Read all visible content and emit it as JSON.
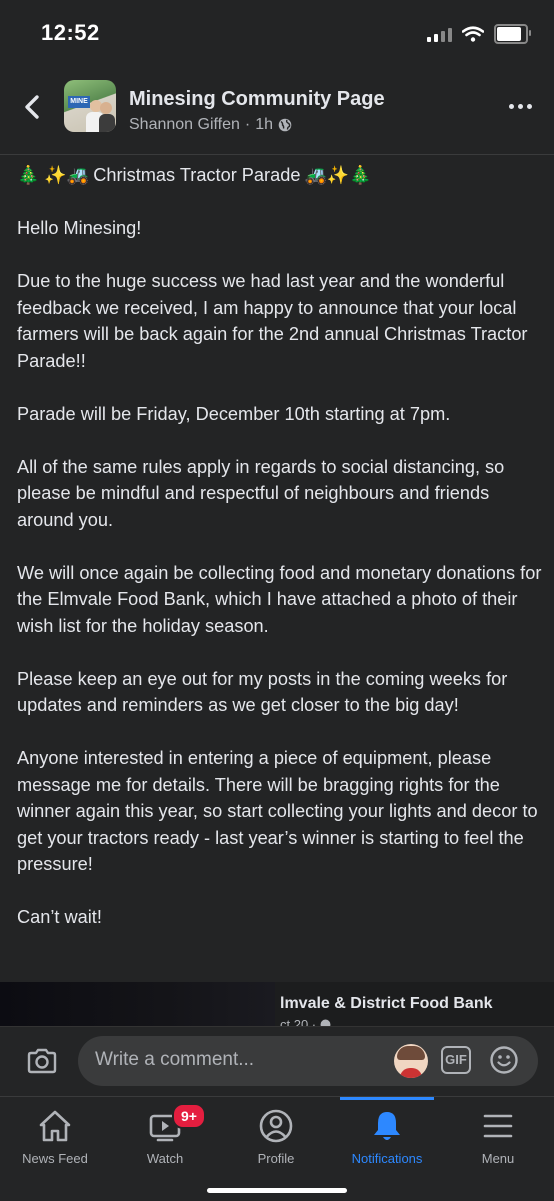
{
  "status_bar": {
    "time": "12:52",
    "battery_percent": 85
  },
  "header": {
    "page_name": "Minesing Community Page",
    "author": "Shannon Giffen",
    "separator": "·",
    "time_ago": "1h",
    "avatar_sign_text": "MINE",
    "icons": [
      "back-arrow-icon",
      "globe-icon",
      "more-options-icon"
    ]
  },
  "post": {
    "title": {
      "lead_emojis": "🎄 ✨🚜",
      "text": "Christmas Tractor Parade",
      "trail_emojis": "🚜✨🎄"
    },
    "paragraphs": [
      "Hello Minesing!",
      "Due to the huge success we had last year and the wonderful feedback we received, I am happy to announce that your local farmers will be back again for the 2nd annual Christmas Tractor Parade!!",
      "Parade will be Friday, December 10th starting at 7pm.",
      "All of the same rules apply in regards to social distancing, so please be mindful and respectful of neighbours and friends around you.",
      "We will once again be collecting food and monetary donations for the Elmvale Food Bank, which I have attached a photo of their wish list for the holiday season.",
      "Please keep an eye out for my posts in the coming weeks for updates and reminders as we get closer to the big day!",
      "Anyone interested in entering a piece of equipment, please message me for details. There will be bragging rights for the winner again this year, so start collecting your lights and decor to get your tractors ready - last year’s winner is starting to feel the pressure!",
      "Can’t wait!"
    ]
  },
  "shared_post": {
    "title": "lmvale & District Food Bank",
    "subtitle": "ct 20 · "
  },
  "comment_bar": {
    "placeholder": "Write a comment...",
    "gif_label": "GIF",
    "icons": [
      "camera-icon",
      "avatar-sticker-icon",
      "gif-icon",
      "emoji-icon"
    ]
  },
  "tab_bar": {
    "tabs": [
      {
        "label": "News Feed",
        "icon": "home-icon",
        "active": false
      },
      {
        "label": "Watch",
        "icon": "watch-icon",
        "active": false,
        "badge": "9+"
      },
      {
        "label": "Profile",
        "icon": "profile-icon",
        "active": false
      },
      {
        "label": "Notifications",
        "icon": "bell-icon",
        "active": true
      },
      {
        "label": "Menu",
        "icon": "menu-icon",
        "active": false
      }
    ]
  },
  "colors": {
    "background": "#232425",
    "text_primary": "#e4e6eb",
    "text_secondary": "#b0b3b8",
    "accent_blue": "#2d88ff",
    "badge_red": "#e41e3f"
  }
}
